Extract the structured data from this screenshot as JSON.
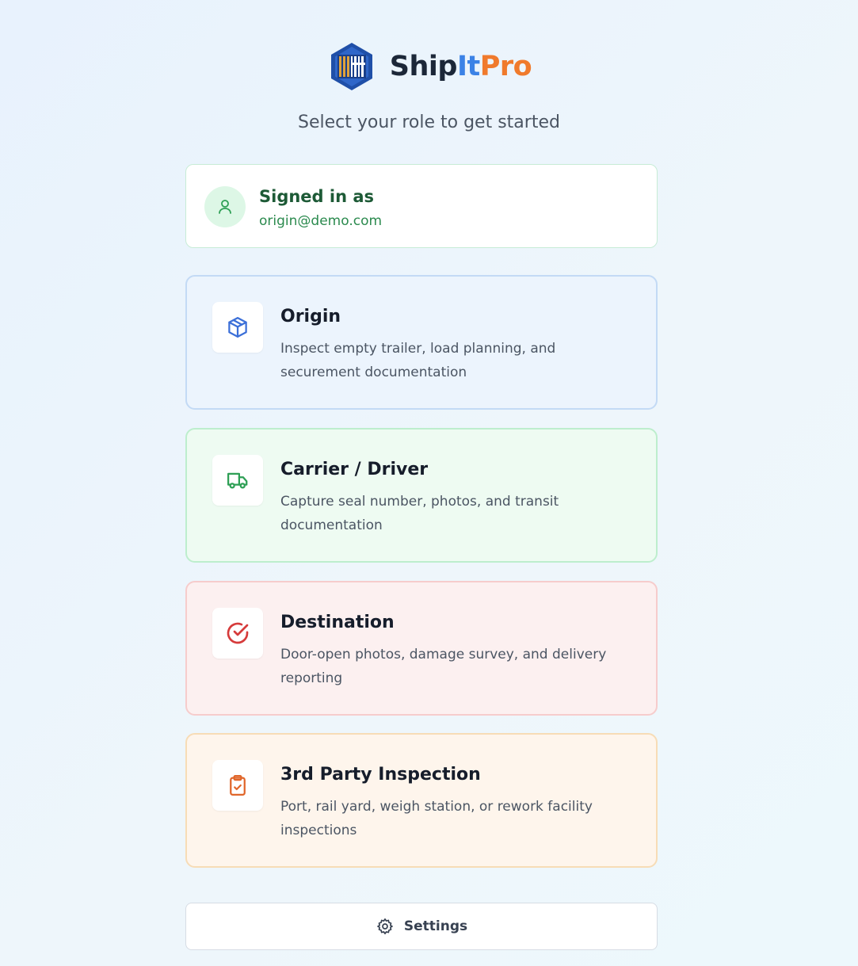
{
  "brand": {
    "name_part1": "Ship",
    "name_part2": "It",
    "name_part3": "Pro",
    "colors": {
      "part1": "#1c2738",
      "part2": "#3b82e6",
      "part3": "#f07a2c",
      "logo": "#1f4fa8",
      "logo_accent": "#e0a23a"
    }
  },
  "subtitle": "Select your role to get started",
  "signed_in": {
    "title": "Signed in as",
    "email": "origin@demo.com",
    "icon": "user-icon"
  },
  "roles": [
    {
      "title": "Origin",
      "description": "Inspect empty trailer, load planning, and securement documentation",
      "icon": "package-icon",
      "accent": "#3b6fd8"
    },
    {
      "title": "Carrier / Driver",
      "description": "Capture seal number, photos, and transit documentation",
      "icon": "truck-icon",
      "accent": "#2e9f55"
    },
    {
      "title": "Destination",
      "description": "Door-open photos, damage survey, and delivery reporting",
      "icon": "check-circle-icon",
      "accent": "#d63b3b"
    },
    {
      "title": "3rd Party Inspection",
      "description": "Port, rail yard, weigh station, or rework facility inspections",
      "icon": "clipboard-check-icon",
      "accent": "#e0662a"
    }
  ],
  "settings": {
    "label": "Settings",
    "icon": "gear-icon"
  }
}
